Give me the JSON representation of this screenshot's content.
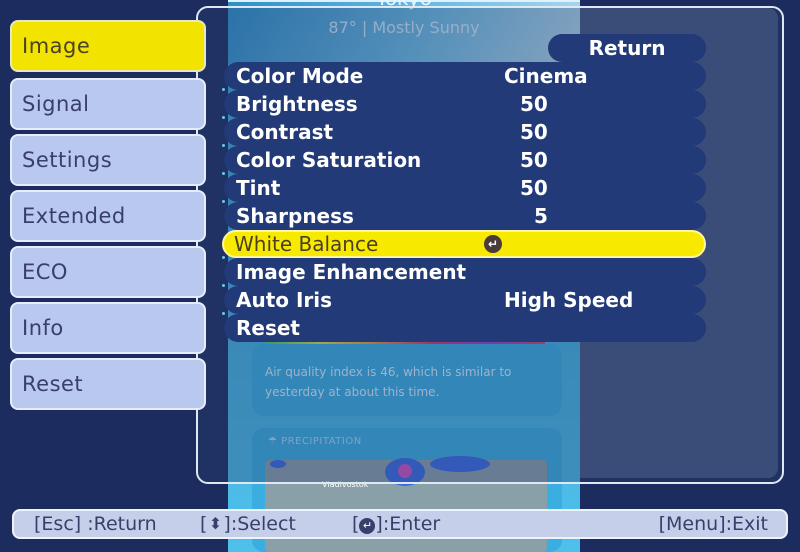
{
  "background": {
    "city": "Tokyo",
    "weather": "87° | Mostly Sunny",
    "aqi_text": "Air quality index is 46, which is similar to yesterday at about this time.",
    "precip_label": "PRECIPITATION",
    "map_city": "Vladivostok"
  },
  "sidebar": {
    "items": [
      {
        "label": "Image",
        "active": true
      },
      {
        "label": "Signal"
      },
      {
        "label": "Settings"
      },
      {
        "label": "Extended"
      },
      {
        "label": "ECO"
      },
      {
        "label": "Info"
      },
      {
        "label": "Reset"
      }
    ]
  },
  "menu": {
    "return_label": "Return",
    "rows": [
      {
        "label": "Color Mode",
        "value": "Cinema"
      },
      {
        "label": "Brightness",
        "value": "50"
      },
      {
        "label": "Contrast",
        "value": "50"
      },
      {
        "label": "Color Saturation",
        "value": "50"
      },
      {
        "label": "Tint",
        "value": "50"
      },
      {
        "label": "Sharpness",
        "value": "5"
      },
      {
        "label": "White Balance",
        "value": "",
        "icon": "enter-icon",
        "selected": true
      },
      {
        "label": "Image Enhancement",
        "value": ""
      },
      {
        "label": "Auto Iris",
        "value": "High Speed"
      },
      {
        "label": "Reset",
        "value": ""
      }
    ]
  },
  "help_bar": {
    "esc": "[Esc] :Return",
    "select_prefix": "[",
    "select_suffix": "]:Select",
    "select_glyph": "⬍",
    "enter_prefix": "[",
    "enter_suffix": "]:Enter",
    "enter_glyph": "↵",
    "menu": "[Menu]:Exit"
  },
  "colors": {
    "highlight": "#f2e400",
    "row_bg": "#223a78",
    "screen_bg": "#1c2c5e",
    "tab_bg": "#b8c8ee"
  }
}
